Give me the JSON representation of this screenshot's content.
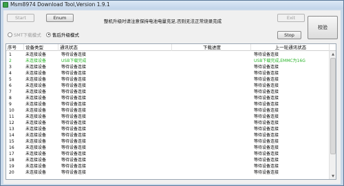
{
  "window": {
    "title": "Msm8974 Download Tool,Version 1.9.1"
  },
  "toolbar": {
    "start": "Start",
    "enum": "Enum",
    "exit": "Exit",
    "stop": "Stop",
    "verify": "校验"
  },
  "notice": "整机升级时请注意保持电池电量充足,否则无法正常烧录完成",
  "modes": [
    {
      "label": "SMT下载模式",
      "checked": false,
      "enabled": false
    },
    {
      "label": "售后升级模式",
      "checked": true,
      "enabled": true
    }
  ],
  "table": {
    "headers": [
      "序号",
      "设备类型",
      "通讯状态",
      "下载进度",
      "上一轮通讯状态"
    ],
    "rows": [
      {
        "no": "1",
        "type": "未连接设备",
        "status": "等待设备连接",
        "progress": "",
        "last": "等待设备连接",
        "highlight": false
      },
      {
        "no": "2",
        "type": "未连接设备",
        "status": "USB下载完成",
        "progress": "",
        "last": "USB下载完成,EMMC为16G",
        "highlight": true
      },
      {
        "no": "3",
        "type": "未连接设备",
        "status": "等待设备连接",
        "progress": "",
        "last": "等待设备连接",
        "highlight": false
      },
      {
        "no": "4",
        "type": "未连接设备",
        "status": "等待设备连接",
        "progress": "",
        "last": "等待设备连接",
        "highlight": false
      },
      {
        "no": "5",
        "type": "未连接设备",
        "status": "等待设备连接",
        "progress": "",
        "last": "等待设备连接",
        "highlight": false
      },
      {
        "no": "6",
        "type": "未连接设备",
        "status": "等待设备连接",
        "progress": "",
        "last": "等待设备连接",
        "highlight": false
      },
      {
        "no": "7",
        "type": "未连接设备",
        "status": "等待设备连接",
        "progress": "",
        "last": "等待设备连接",
        "highlight": false
      },
      {
        "no": "8",
        "type": "未连接设备",
        "status": "等待设备连接",
        "progress": "",
        "last": "等待设备连接",
        "highlight": false
      },
      {
        "no": "9",
        "type": "未连接设备",
        "status": "等待设备连接",
        "progress": "",
        "last": "等待设备连接",
        "highlight": false
      },
      {
        "no": "10",
        "type": "未连接设备",
        "status": "等待设备连接",
        "progress": "",
        "last": "等待设备连接",
        "highlight": false
      },
      {
        "no": "11",
        "type": "未连接设备",
        "status": "等待设备连接",
        "progress": "",
        "last": "等待设备连接",
        "highlight": false
      },
      {
        "no": "12",
        "type": "未连接设备",
        "status": "等待设备连接",
        "progress": "",
        "last": "等待设备连接",
        "highlight": false
      },
      {
        "no": "13",
        "type": "未连接设备",
        "status": "等待设备连接",
        "progress": "",
        "last": "等待设备连接",
        "highlight": false
      },
      {
        "no": "14",
        "type": "未连接设备",
        "status": "等待设备连接",
        "progress": "",
        "last": "等待设备连接",
        "highlight": false
      },
      {
        "no": "15",
        "type": "未连接设备",
        "status": "等待设备连接",
        "progress": "",
        "last": "等待设备连接",
        "highlight": false
      },
      {
        "no": "16",
        "type": "未连接设备",
        "status": "等待设备连接",
        "progress": "",
        "last": "等待设备连接",
        "highlight": false
      },
      {
        "no": "17",
        "type": "未连接设备",
        "status": "等待设备连接",
        "progress": "",
        "last": "等待设备连接",
        "highlight": false
      },
      {
        "no": "18",
        "type": "未连接设备",
        "status": "等待设备连接",
        "progress": "",
        "last": "等待设备连接",
        "highlight": false
      },
      {
        "no": "19",
        "type": "未连接设备",
        "status": "等待设备连接",
        "progress": "",
        "last": "等待设备连接",
        "highlight": false
      },
      {
        "no": "20",
        "type": "未连接设备",
        "status": "等待设备连接",
        "progress": "",
        "last": "等待设备连接",
        "highlight": false
      }
    ]
  },
  "colors": {
    "highlight_row": "#27b327",
    "title_bar": "#c2d5ea"
  }
}
